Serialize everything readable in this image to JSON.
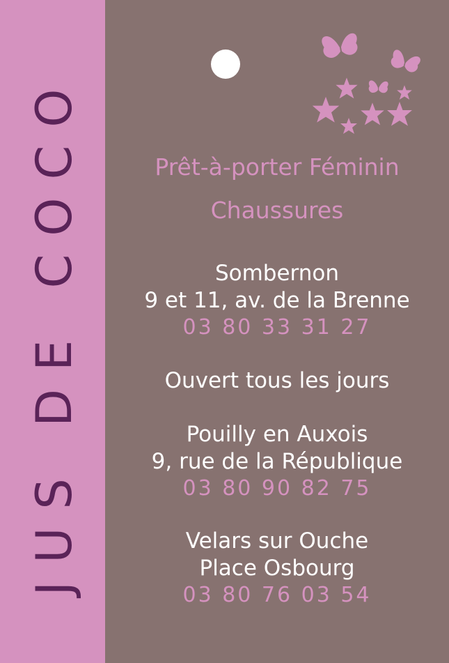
{
  "brand": {
    "name": "JUS DE COCO"
  },
  "tagline": {
    "line1": "Prêt-à-porter Féminin",
    "line2": "Chaussures"
  },
  "stores": [
    {
      "city": "Sombernon",
      "address": "9 et 11, av. de la Brenne",
      "phone": "03 80 33 31 27"
    },
    {
      "city": "Pouilly en Auxois",
      "address": "9, rue de la République",
      "phone": "03 80 90 82 75"
    },
    {
      "city": "Velars sur Ouche",
      "address": "Place Osbourg",
      "phone": "03 80 76 03 54"
    }
  ],
  "hours": "Ouvert tous les jours",
  "decoration": {
    "icons": [
      "butterfly-icon",
      "star-icon"
    ]
  },
  "colors": {
    "background": "#877270",
    "side_band": "#d592bf",
    "brand_text": "#5a2358",
    "accent_pink": "#d592bf",
    "text_white": "#ffffff"
  }
}
